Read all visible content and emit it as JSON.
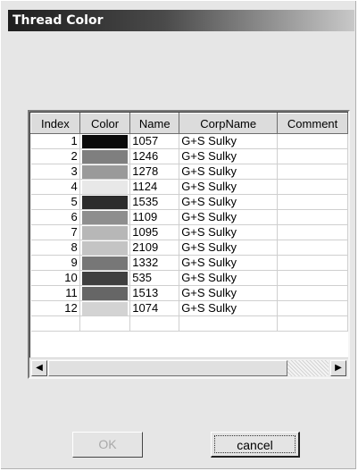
{
  "window": {
    "title": "Thread Color"
  },
  "grid": {
    "columns": [
      "Index",
      "Color",
      "Name",
      "CorpName",
      "Comment"
    ],
    "rows": [
      {
        "index": "1",
        "color": "#0a0a0a",
        "name": "1057",
        "corp": "G+S Sulky",
        "comment": ""
      },
      {
        "index": "2",
        "color": "#7f7f7f",
        "name": "1246",
        "corp": "G+S Sulky",
        "comment": ""
      },
      {
        "index": "3",
        "color": "#9a9a9a",
        "name": "1278",
        "corp": "G+S Sulky",
        "comment": ""
      },
      {
        "index": "4",
        "color": "#e8e8e8",
        "name": "1124",
        "corp": "G+S Sulky",
        "comment": ""
      },
      {
        "index": "5",
        "color": "#2c2c2c",
        "name": "1535",
        "corp": "G+S Sulky",
        "comment": ""
      },
      {
        "index": "6",
        "color": "#8e8e8e",
        "name": "1109",
        "corp": "G+S Sulky",
        "comment": ""
      },
      {
        "index": "7",
        "color": "#b7b7b7",
        "name": "1095",
        "corp": "G+S Sulky",
        "comment": ""
      },
      {
        "index": "8",
        "color": "#c4c4c4",
        "name": "2109",
        "corp": "G+S Sulky",
        "comment": ""
      },
      {
        "index": "9",
        "color": "#777777",
        "name": "1332",
        "corp": "G+S Sulky",
        "comment": ""
      },
      {
        "index": "10",
        "color": "#404040",
        "name": "535",
        "corp": "G+S Sulky",
        "comment": ""
      },
      {
        "index": "11",
        "color": "#666666",
        "name": "1513",
        "corp": "G+S Sulky",
        "comment": ""
      },
      {
        "index": "12",
        "color": "#d3d3d3",
        "name": "1074",
        "corp": "G+S Sulky",
        "comment": ""
      }
    ],
    "scroll_left_icon": "arrow-left-icon",
    "scroll_right_icon": "arrow-right-icon"
  },
  "buttons": {
    "ok_label": "OK",
    "ok_enabled": false,
    "cancel_label": "cancel"
  }
}
